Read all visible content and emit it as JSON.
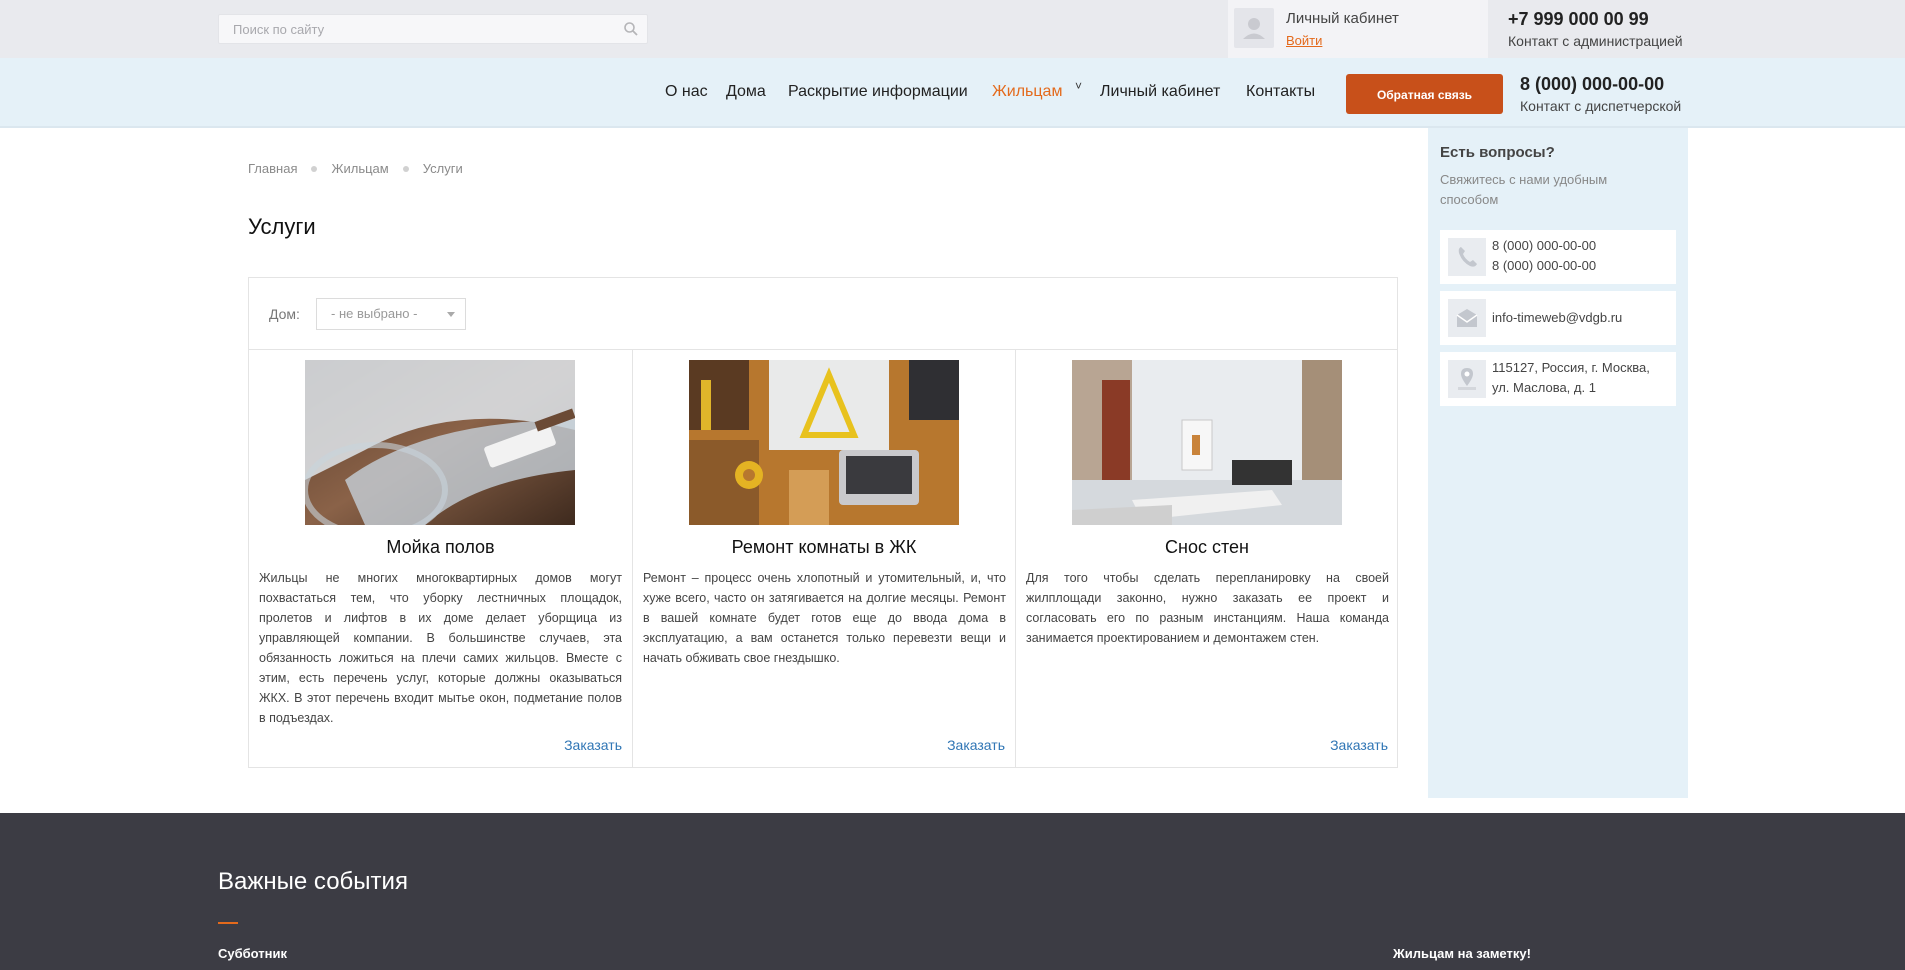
{
  "header": {
    "search_placeholder": "Поиск по сайту",
    "cabinet_title": "Личный кабинет",
    "cabinet_login": "Войти",
    "admin_phone": "+7 999 000 00 99",
    "admin_label": "Контакт с администрацией"
  },
  "nav": {
    "items": [
      "О нас",
      "Дома",
      "Раскрытие информации",
      "Жильцам",
      "Личный кабинет",
      "Контакты"
    ],
    "active": "Жильцам",
    "caret": "˅",
    "feedback_button": "Обратная связь",
    "dispatcher_phone": "8 (000) 000-00-00",
    "dispatcher_label": "Контакт с диспетчерской"
  },
  "breadcrumb": [
    "Главная",
    "Жильцам",
    "Услуги"
  ],
  "page_title": "Услуги",
  "filter": {
    "label": "Дом:",
    "selected": "- не выбрано -"
  },
  "services": [
    {
      "title": "Мойка полов",
      "description": "Жильцы не многих многоквартирных домов могут похвастаться тем, что уборку лестничных площадок, пролетов и лифтов в их доме делает уборщица из управляющей компании. В большинстве случаев, эта обязанность ложиться на плечи самих жильцов. Вместе с этим, есть перечень услуг, которые должны оказываться ЖКХ. В этот перечень входит мытье окон, подметание полов в подъездах.",
      "order": "Заказать"
    },
    {
      "title": "Ремонт комнаты в ЖК",
      "description": "Ремонт – процесс очень хлопотный и утомительный, и, что хуже всего, часто он затягивается на долгие месяцы. Ремонт в вашей комнате будет готов еще до ввода дома в эксплуатацию, а вам останется только перевезти вещи и начать обживать свое гнездышко.",
      "order": "Заказать"
    },
    {
      "title": "Снос стен",
      "description": "Для того чтобы сделать перепланировку на своей жилплощади законно, нужно заказать ее проект и согласовать его по разным инстанциям. Наша команда занимается проектированием и демонтажем стен.",
      "order": "Заказать"
    }
  ],
  "sidebar": {
    "question": "Есть вопросы?",
    "subtitle": "Свяжитесь с нами удобным способом",
    "phone1": "8 (000) 000-00-00",
    "phone2": "8 (000) 000-00-00",
    "email": "info-timeweb@vdgb.ru",
    "address1": "115127, Россия, г. Москва,",
    "address2": "ул. Маслова, д. 1"
  },
  "footer": {
    "title": "Важные события",
    "left_item": "Субботник",
    "right_item": "Жильцам на заметку!"
  },
  "colors": {
    "accent": "#e46a1c",
    "button": "#c8501a",
    "nav_bg": "#e5f1f8",
    "footer_bg": "#3c3c44",
    "link": "#3076b5"
  }
}
